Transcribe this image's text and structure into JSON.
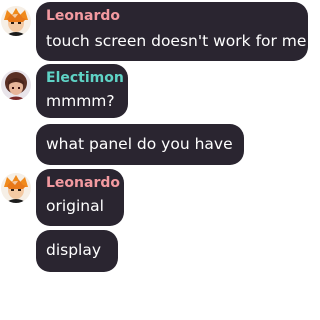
{
  "colors": {
    "bubble": "#2a2530",
    "leonardo_name": "#f39aa0",
    "electimon_name": "#5fd3c6"
  },
  "messages": [
    {
      "author": "Leonardo",
      "avatar_icon": "orange-haired-avatar-icon",
      "text": "touch screen doesn't work for me"
    },
    {
      "author": "Electimon",
      "avatar_icon": "dark-haired-avatar-icon",
      "text": "mmmm?"
    },
    {
      "author": "",
      "text": "what panel do you have"
    },
    {
      "author": "Leonardo",
      "avatar_icon": "orange-haired-avatar-icon",
      "text": "original"
    },
    {
      "author": "",
      "text": "display"
    }
  ]
}
